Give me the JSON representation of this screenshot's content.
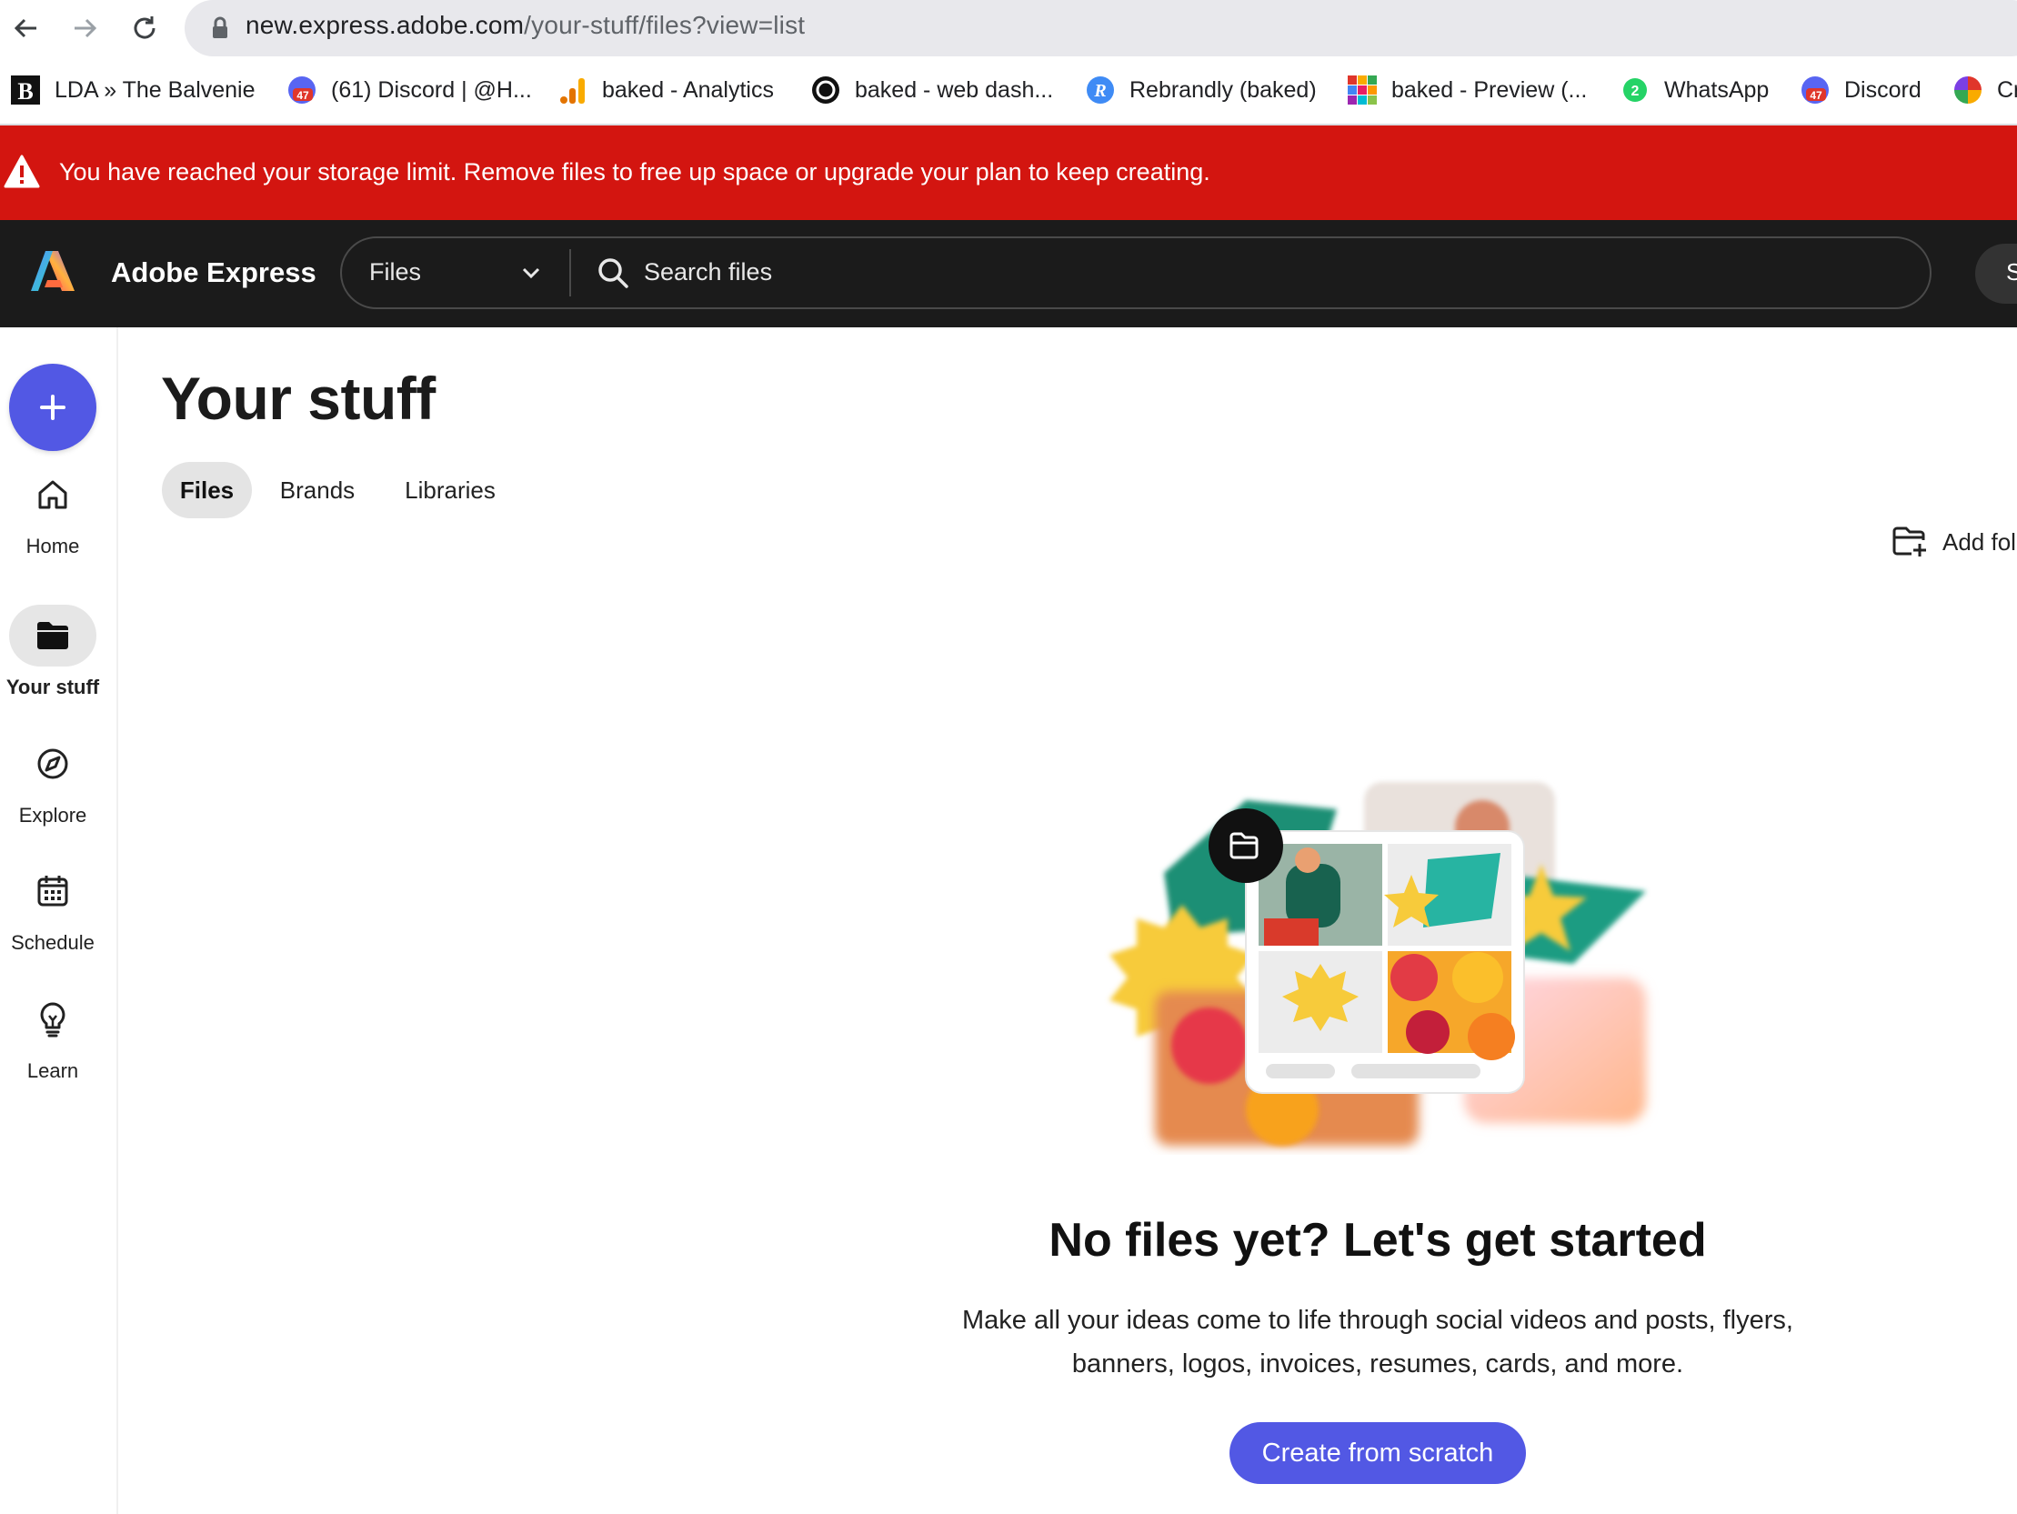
{
  "browser": {
    "url_host": "new.express.adobe.com",
    "url_path": "/your-stuff/files?view=list",
    "bookmarks": [
      {
        "label": "LDA » The Balvenie",
        "icon": "b-logo-icon"
      },
      {
        "label": "(61) Discord | @H...",
        "icon": "discord-icon",
        "badge": "47"
      },
      {
        "label": "baked - Analytics",
        "icon": "analytics-icon"
      },
      {
        "label": "baked - web dash...",
        "icon": "circle-logo-icon"
      },
      {
        "label": "Rebrandly (baked)",
        "icon": "rebrandly-icon",
        "glyph": "R"
      },
      {
        "label": "baked - Preview (...",
        "icon": "grid-logo-icon"
      },
      {
        "label": "WhatsApp",
        "icon": "whatsapp-icon",
        "badge": "2"
      },
      {
        "label": "Discord",
        "icon": "discord-icon",
        "badge": "47"
      },
      {
        "label": "Cr",
        "icon": "color-wheel-icon"
      }
    ]
  },
  "alert": {
    "message": "You have reached your storage limit. Remove files to free up space or upgrade your plan to keep creating."
  },
  "header": {
    "app_name": "Adobe Express",
    "search_scope": "Files",
    "search_placeholder": "Search files",
    "right_button": "S"
  },
  "sidenav": {
    "items": [
      {
        "label": "Home",
        "icon": "home-icon",
        "active": false
      },
      {
        "label": "Your stuff",
        "icon": "folder-icon",
        "active": true
      },
      {
        "label": "Explore",
        "icon": "compass-icon",
        "active": false
      },
      {
        "label": "Schedule",
        "icon": "calendar-icon",
        "active": false
      },
      {
        "label": "Learn",
        "icon": "lightbulb-icon",
        "active": false
      }
    ]
  },
  "main": {
    "title": "Your stuff",
    "tabs": [
      {
        "label": "Files",
        "active": true
      },
      {
        "label": "Brands",
        "active": false
      },
      {
        "label": "Libraries",
        "active": false
      }
    ],
    "add_folder": "Add fol",
    "empty_state": {
      "title": "No files yet? Let's get started",
      "description": "Make all your ideas come to life through social videos and posts, flyers, banners, logos, invoices, resumes, cards, and more.",
      "cta": "Create from scratch"
    }
  },
  "colors": {
    "alert": "#d31510",
    "header_bg": "#1b1b1b",
    "accent": "#5258e4"
  }
}
